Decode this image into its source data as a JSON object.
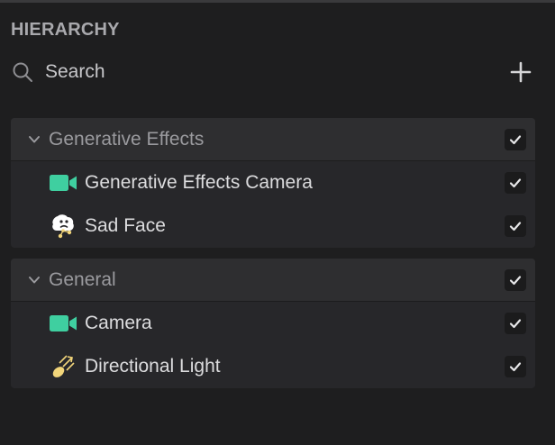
{
  "panel": {
    "title": "HIERARCHY"
  },
  "search": {
    "label": "Search",
    "icon": "search-icon"
  },
  "toolbar": {
    "add_icon": "plus-icon"
  },
  "groups": [
    {
      "label": "Generative Effects",
      "expanded": true,
      "checked": true,
      "items": [
        {
          "label": "Generative Effects Camera",
          "icon": "camera-icon",
          "icon_color": "#3fcfa0",
          "checked": true
        },
        {
          "label": "Sad Face",
          "icon": "face-effect-icon",
          "icon_color": "#ffffff",
          "checked": true
        }
      ]
    },
    {
      "label": "General",
      "expanded": true,
      "checked": true,
      "items": [
        {
          "label": "Camera",
          "icon": "camera-icon",
          "icon_color": "#3fcfa0",
          "checked": true
        },
        {
          "label": "Directional Light",
          "icon": "directional-light-icon",
          "icon_color": "#f2d57a",
          "checked": true
        }
      ]
    }
  ],
  "colors": {
    "background": "#1e1e1f",
    "group_bg": "#27272a",
    "header_bg": "#2e2e30",
    "accent_camera": "#3fcfa0",
    "accent_light": "#f2d57a"
  }
}
